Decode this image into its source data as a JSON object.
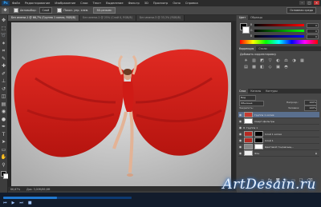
{
  "app": {
    "logo_text": "Ps",
    "menu": [
      "Файл",
      "Редактирование",
      "Изображение",
      "Слои",
      "Текст",
      "Выделение",
      "Фильтр",
      "3D",
      "Просмотр",
      "Окно",
      "Справка"
    ],
    "window_controls": [
      "–",
      "□",
      "✕"
    ]
  },
  "options_bar": {
    "tool_icon": "move-icon",
    "auto_select_label": "Автовыбор:",
    "auto_select_value": "Слой",
    "transform_label": "Показ. упр. элем.",
    "mode_3d_label": "3D-режим:",
    "workspace": "Основная среда"
  },
  "tabs": [
    {
      "label": "Без имени-1 @ 66,7% (Группа 1 копия, RGB/8)",
      "active": true
    },
    {
      "label": "Без имени-2 @ 25% (Слой 0, RGB/8)",
      "active": false
    },
    {
      "label": "Без имени-3 @ 33,3% (RGB/8)",
      "active": false
    }
  ],
  "status": {
    "zoom": "66,67%",
    "doc": "Док: 3,00М/69,6М"
  },
  "color_panel": {
    "tabs": [
      "Цвет",
      "Образцы"
    ],
    "channels": [
      {
        "label": "R",
        "value": "0"
      },
      {
        "label": "G",
        "value": "0"
      },
      {
        "label": "B",
        "value": "0"
      }
    ]
  },
  "adjustments_panel": {
    "tabs": [
      "Коррекция",
      "Стили"
    ],
    "heading": "Добавить корректировку",
    "icons": [
      "☀",
      "▥",
      "◩",
      "▽",
      "◐",
      "⚖",
      "◑",
      "▦",
      "▤",
      "▩",
      "◧",
      "◇",
      "▣",
      "◓"
    ]
  },
  "layers_panel": {
    "tabs": [
      "Слои",
      "Каналы",
      "Контуры"
    ],
    "kind_filter": "Вид",
    "blend_mode": "Обычные",
    "opacity_label": "Непрозр.:",
    "opacity": "100%",
    "lock_label": "Закрепить:",
    "fill_label": "Заливка:",
    "fill": "100%",
    "layers": [
      {
        "name": "Группа 1 копия",
        "selected": true,
        "kind": "group"
      },
      {
        "name": "Смарт-фильтры",
        "selected": false,
        "kind": "filter"
      },
      {
        "name": "Группа 1",
        "selected": false,
        "kind": "group"
      },
      {
        "name": "Слой 1 копия",
        "selected": false,
        "kind": "layer"
      },
      {
        "name": "Слой 1",
        "selected": false,
        "kind": "layer"
      },
      {
        "name": "Цветовой тон/насыщ...",
        "selected": false,
        "kind": "adjustment"
      },
      {
        "name": "Фон",
        "selected": false,
        "kind": "background"
      }
    ]
  },
  "taskbar": {
    "progress": 0.42,
    "controls": [
      "⏮",
      "▶",
      "⏭",
      "■"
    ]
  },
  "watermark": "ArtDesain.ru",
  "colors": {
    "dress_red": "#d4201b",
    "dress_shadow": "#9c1010",
    "backdrop": "#c2c2c2",
    "ui_panel": "#474747",
    "selection": "#5a6f8e"
  }
}
